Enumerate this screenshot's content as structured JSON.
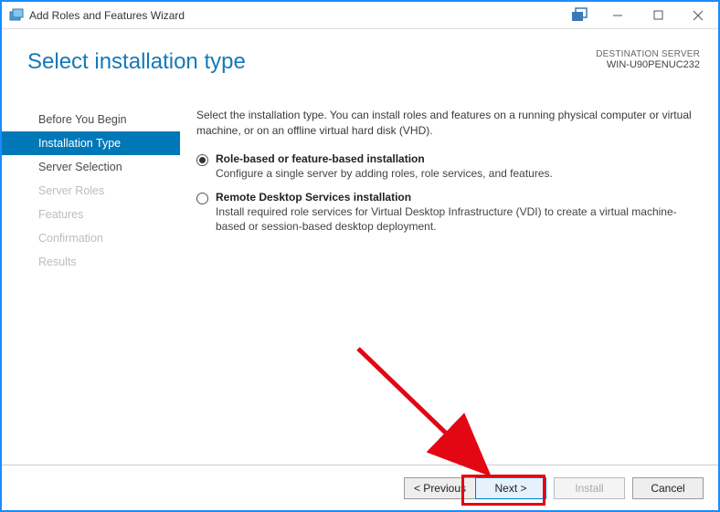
{
  "window": {
    "title": "Add Roles and Features Wizard"
  },
  "header": {
    "page_title": "Select installation type",
    "dest_label": "DESTINATION SERVER",
    "dest_value": "WIN-U90PENUC232"
  },
  "nav": {
    "items": [
      {
        "label": "Before You Begin",
        "state": "normal"
      },
      {
        "label": "Installation Type",
        "state": "selected"
      },
      {
        "label": "Server Selection",
        "state": "normal"
      },
      {
        "label": "Server Roles",
        "state": "disabled"
      },
      {
        "label": "Features",
        "state": "disabled"
      },
      {
        "label": "Confirmation",
        "state": "disabled"
      },
      {
        "label": "Results",
        "state": "disabled"
      }
    ]
  },
  "main": {
    "intro": "Select the installation type. You can install roles and features on a running physical computer or virtual machine, or on an offline virtual hard disk (VHD).",
    "options": [
      {
        "title": "Role-based or feature-based installation",
        "desc": "Configure a single server by adding roles, role services, and features.",
        "checked": true
      },
      {
        "title": "Remote Desktop Services installation",
        "desc": "Install required role services for Virtual Desktop Infrastructure (VDI) to create a virtual machine-based or session-based desktop deployment.",
        "checked": false
      }
    ]
  },
  "footer": {
    "previous": "< Previous",
    "next": "Next >",
    "install": "Install",
    "cancel": "Cancel"
  }
}
